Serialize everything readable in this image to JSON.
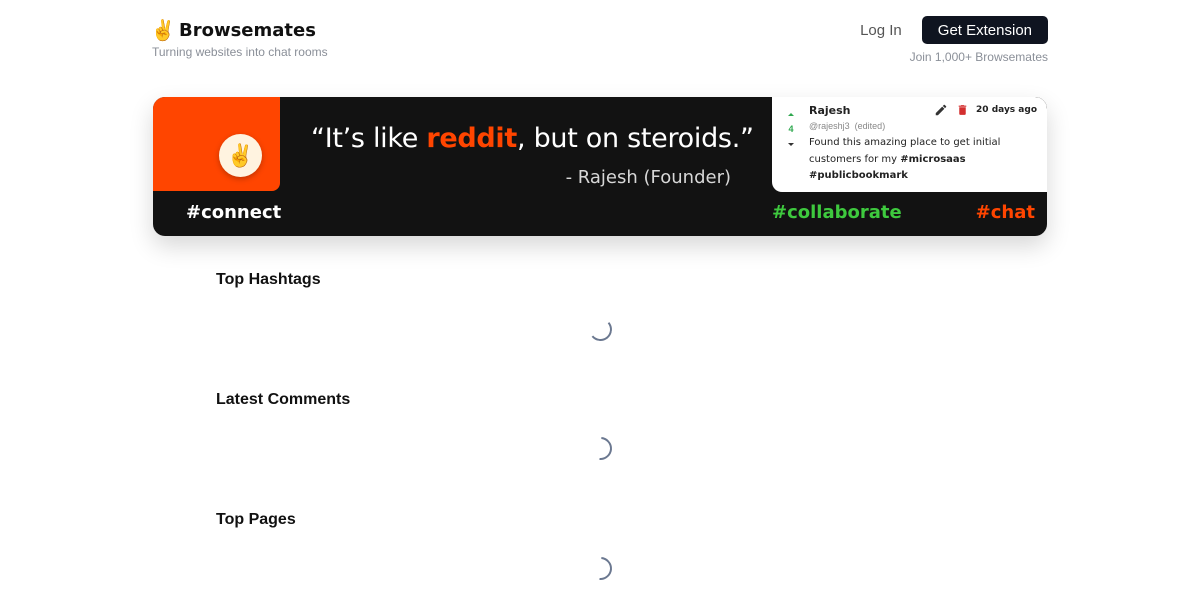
{
  "header": {
    "brand_emoji": "✌️",
    "brand_name": "Browsemates",
    "tagline": "Turning websites into chat rooms",
    "login_label": "Log In",
    "cta_label": "Get Extension",
    "join_text": "Join 1,000+ Browsemates"
  },
  "banner": {
    "avatar_emoji": "✌️",
    "quote_open": "“It’s like ",
    "quote_highlight": "reddit",
    "quote_close": ", but on steroids.”",
    "attribution": "- Rajesh (Founder)",
    "tags": [
      "#connect",
      "#collaborate",
      "#chat"
    ],
    "colors": {
      "accent": "#ff4500",
      "green": "#3ec93e",
      "dark": "#121212"
    }
  },
  "comment": {
    "author": "Rajesh",
    "handle": "@rajeshj3",
    "edited": "(edited)",
    "votes": "4",
    "time": "20 days ago",
    "body_text": "Found this amazing place to get initial customers for my ",
    "hashtag_1": "#microsaas",
    "hashtag_2": "#publicbookmark",
    "icons": [
      "pencil-icon",
      "trash-icon"
    ]
  },
  "sections": {
    "top_hashtags": "Top Hashtags",
    "latest_comments": "Latest Comments",
    "top_pages": "Top Pages"
  }
}
